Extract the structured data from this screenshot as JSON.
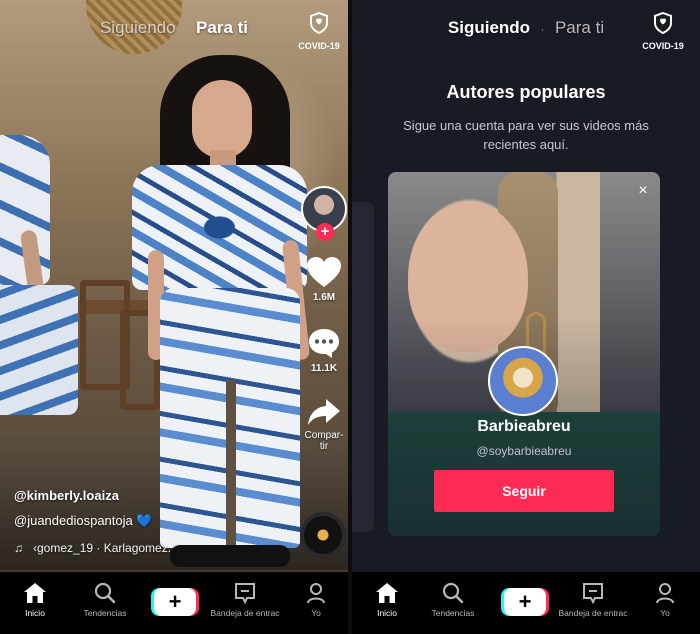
{
  "left": {
    "tabs": [
      "Siguiendo",
      "Para ti"
    ],
    "active_tab": "Para ti",
    "covid_label": "COVID-19",
    "rail": {
      "likes": "1.6M",
      "comments": "11.1K",
      "share": "Compar-tir"
    },
    "caption": {
      "username": "@kimberly.loaiza",
      "mention": "@juandediospantoja",
      "mention_emoji": "💙",
      "music": "‹gomez_19 · Karlagomez."
    }
  },
  "right": {
    "tabs": [
      "Siguiendo",
      "Para ti"
    ],
    "active_tab": "Siguiendo",
    "covid_label": "COVID-19",
    "title": "Autores populares",
    "subtitle": "Sigue una cuenta para ver sus videos más recientes aquí.",
    "creator": {
      "name": "Barbieabreu",
      "handle": "@soybarbieabreu",
      "follow_label": "Seguir",
      "close_symbol": "×"
    }
  },
  "nav": {
    "home": "Inicio",
    "trends": "Tendencias",
    "inbox": "Bandeja de entrac",
    "me": "Yo",
    "create_symbol": "+"
  },
  "colors": {
    "accent": "#fe2c55",
    "cyan": "#25f4ee",
    "panel_dark": "#181a24"
  },
  "icons": [
    "shield-icon",
    "heart-icon",
    "comment-icon",
    "share-icon",
    "music-note-icon",
    "home-icon",
    "search-icon",
    "inbox-icon",
    "person-icon",
    "close-icon",
    "plus-icon"
  ]
}
